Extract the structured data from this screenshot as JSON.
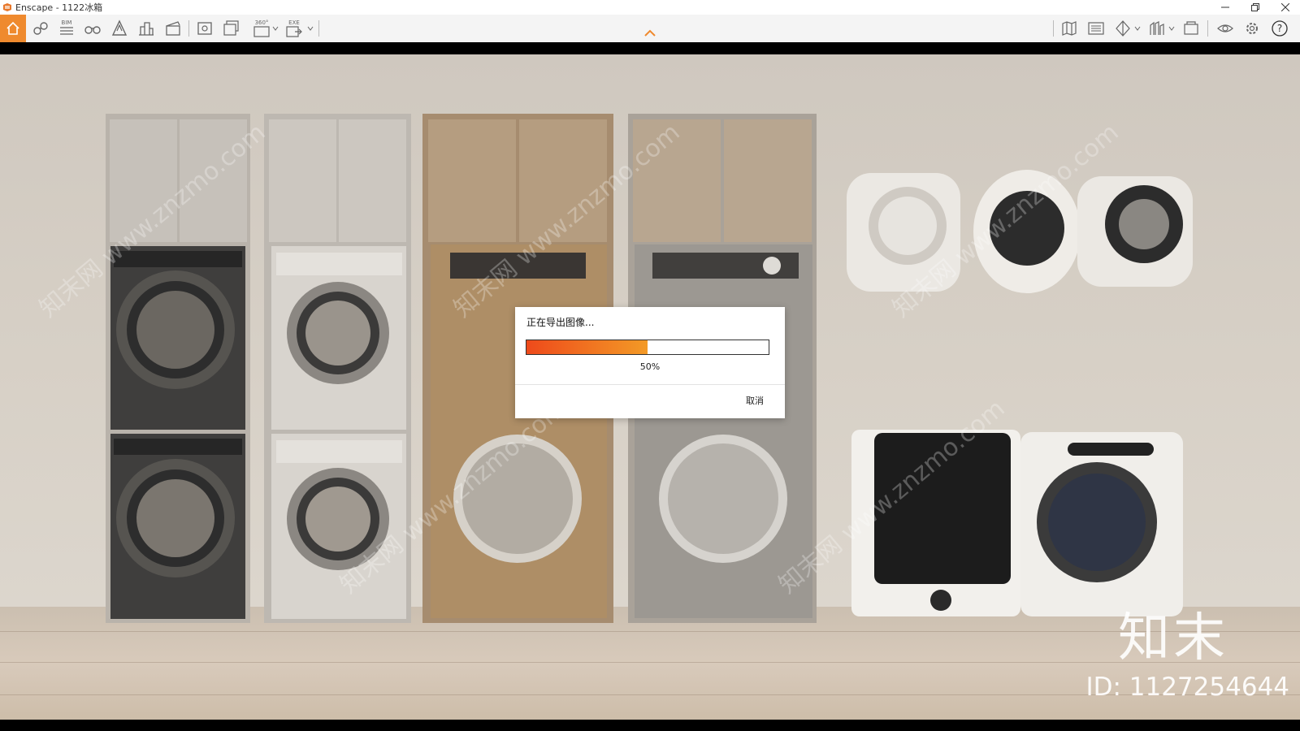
{
  "window": {
    "title": "Enscape - 1122冰箱",
    "controls": [
      "minimize-icon",
      "restore-icon",
      "close-icon"
    ]
  },
  "toolbar": {
    "left_icons": [
      "home-icon",
      "link-icon",
      "bim-icon",
      "binoculars-icon",
      "building-a-icon",
      "city-icon",
      "clapboard-icon",
      "screenshot-icon",
      "batch-render-icon",
      "panorama-360-icon",
      "export-exe-icon"
    ],
    "right_icons": [
      "map-icon",
      "image-view-icon",
      "compare-icon",
      "library-icon",
      "material-icon",
      "visibility-icon",
      "settings-icon",
      "help-icon"
    ],
    "bim_label": "BIM",
    "pano_label": "360°",
    "exe_label": "EXE",
    "accent": "#ef8a2e"
  },
  "dialog": {
    "title": "正在导出图像...",
    "progress_percent": 50,
    "progress_text": "50%",
    "cancel_label": "取消",
    "progress_colors": [
      "#ee4a1b",
      "#f39a26"
    ]
  },
  "watermark": {
    "site": "知末网 www.znzmo.com",
    "brand": "知末",
    "id_text": "ID: 1127254644"
  }
}
